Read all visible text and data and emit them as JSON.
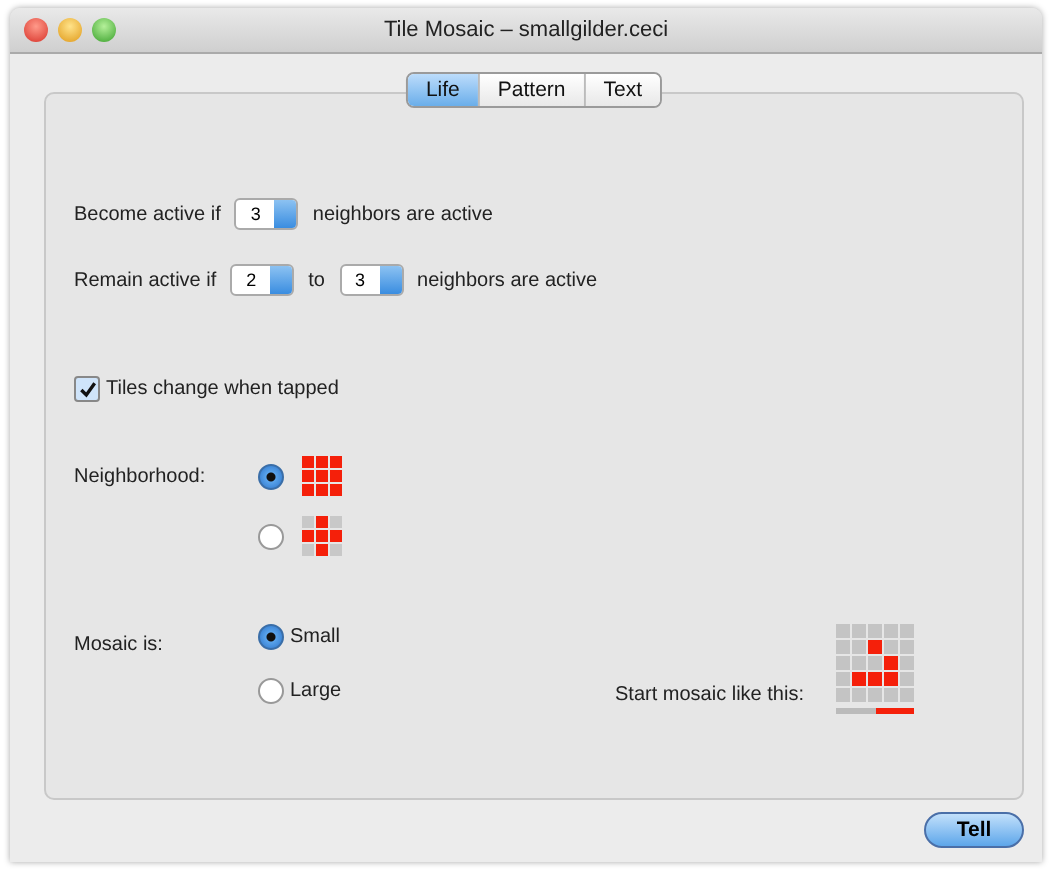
{
  "window": {
    "title": "Tile Mosaic – smallgilder.ceci"
  },
  "tabs": [
    {
      "label": "Life",
      "selected": true
    },
    {
      "label": "Pattern",
      "selected": false
    },
    {
      "label": "Text",
      "selected": false
    }
  ],
  "become": {
    "label": "Become active if",
    "value": "3",
    "suffix": "neighbors are active"
  },
  "remain": {
    "label": "Remain active if",
    "from": "2",
    "to_label": "to",
    "to": "3",
    "suffix": "neighbors are active"
  },
  "tap_checkbox": {
    "label": "Tiles change when tapped",
    "checked": true
  },
  "neighborhood": {
    "label": "Neighborhood:",
    "options": [
      {
        "kind": "square",
        "selected": true
      },
      {
        "kind": "cross",
        "selected": false
      }
    ]
  },
  "mosaic_size": {
    "label": "Mosaic is:",
    "options": [
      {
        "label": "Small",
        "selected": true
      },
      {
        "label": "Large",
        "selected": false
      }
    ]
  },
  "start": {
    "label": "Start mosaic like this:",
    "cells": [
      [
        false,
        false,
        false,
        false,
        false
      ],
      [
        false,
        false,
        true,
        false,
        false
      ],
      [
        false,
        false,
        false,
        true,
        false
      ],
      [
        false,
        true,
        true,
        true,
        false
      ],
      [
        false,
        false,
        false,
        false,
        false
      ]
    ]
  },
  "buttons": [
    "Tell"
  ]
}
